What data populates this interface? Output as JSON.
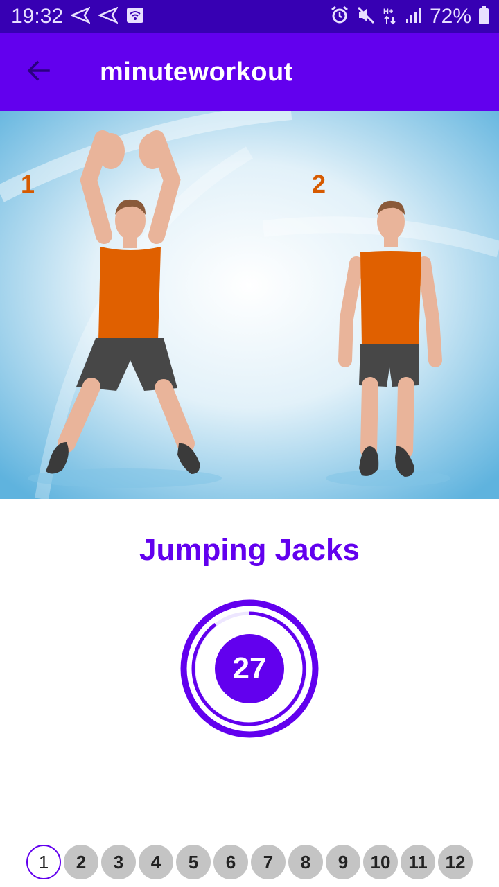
{
  "status_bar": {
    "time": "19:32",
    "battery": "72%",
    "icons": [
      "navigation-icon",
      "navigation-icon",
      "wifi-icon",
      "alarm-icon",
      "mute-icon",
      "hplus-data-icon",
      "signal-icon",
      "battery-icon"
    ]
  },
  "app_bar": {
    "title": "minuteworkout",
    "back_icon": "arrow-back-icon"
  },
  "hero": {
    "label_1": "1",
    "label_2": "2"
  },
  "exercise": {
    "name": "Jumping Jacks",
    "timer_value": "27"
  },
  "exercise_list": {
    "items": [
      "1",
      "2",
      "3",
      "4",
      "5",
      "6",
      "7",
      "8",
      "9",
      "10",
      "11",
      "12"
    ],
    "current": "1"
  },
  "colors": {
    "status_bar": "#3700b3",
    "app_bar": "#6200ee",
    "accent": "#6200ee",
    "inactive_item": "#c4c4c4",
    "shirt": "#e06000"
  }
}
